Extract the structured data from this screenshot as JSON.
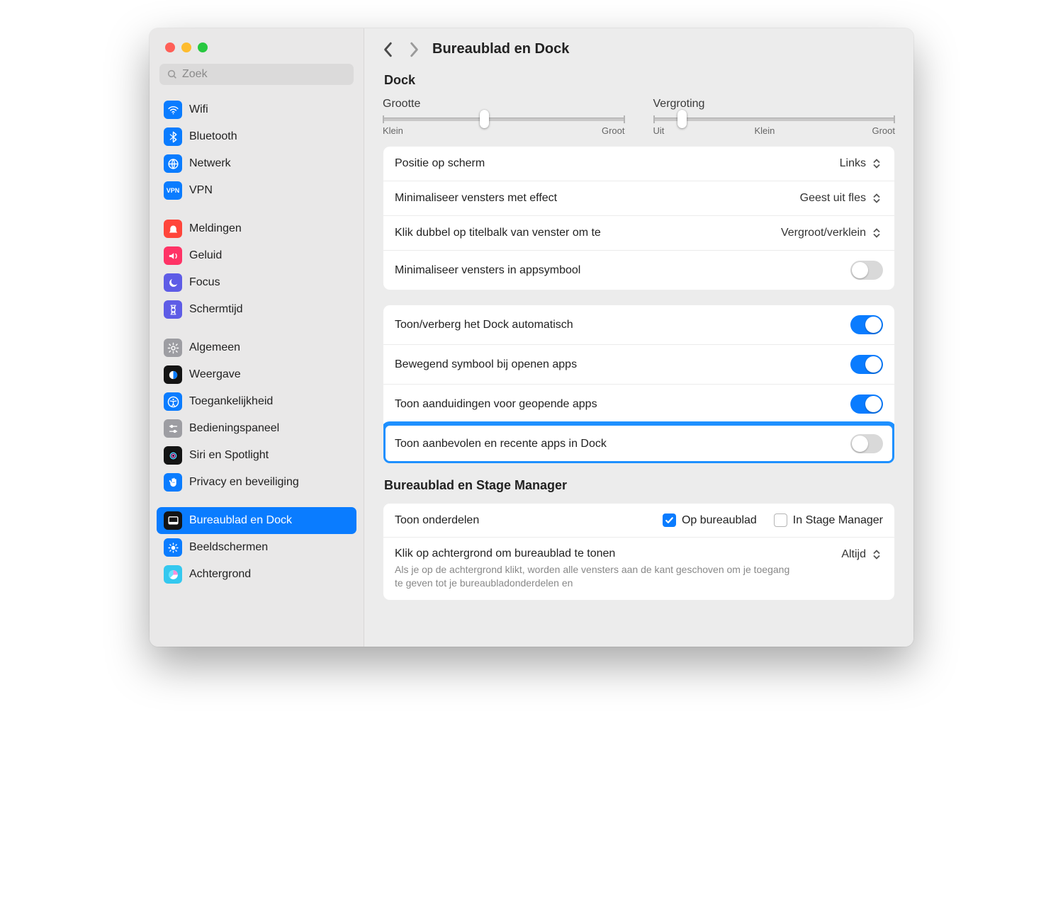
{
  "search": {
    "placeholder": "Zoek"
  },
  "header": {
    "title": "Bureaublad en Dock"
  },
  "sidebar": {
    "groups": [
      [
        {
          "label": "Wifi",
          "bg": "#0a7cff",
          "glyph": "wifi"
        },
        {
          "label": "Bluetooth",
          "bg": "#0a7cff",
          "glyph": "bluetooth"
        },
        {
          "label": "Netwerk",
          "bg": "#0a7cff",
          "glyph": "globe"
        },
        {
          "label": "VPN",
          "bg": "#0a7cff",
          "glyph": "vpn"
        }
      ],
      [
        {
          "label": "Meldingen",
          "bg": "#ff453a",
          "glyph": "bell"
        },
        {
          "label": "Geluid",
          "bg": "#ff3366",
          "glyph": "sound"
        },
        {
          "label": "Focus",
          "bg": "#5e5ce6",
          "glyph": "moon"
        },
        {
          "label": "Schermtijd",
          "bg": "#5e5ce6",
          "glyph": "hourglass"
        }
      ],
      [
        {
          "label": "Algemeen",
          "bg": "#9d9da2",
          "glyph": "gear"
        },
        {
          "label": "Weergave",
          "bg": "#141414",
          "glyph": "appearance"
        },
        {
          "label": "Toegankelijkheid",
          "bg": "#0a7cff",
          "glyph": "accessibility"
        },
        {
          "label": "Bedieningspaneel",
          "bg": "#9d9da2",
          "glyph": "sliders"
        },
        {
          "label": "Siri en Spotlight",
          "bg": "#141414",
          "glyph": "siri"
        },
        {
          "label": "Privacy en beveiliging",
          "bg": "#0a7cff",
          "glyph": "hand"
        }
      ],
      [
        {
          "label": "Bureaublad en Dock",
          "bg": "#141414",
          "glyph": "dock",
          "selected": true
        },
        {
          "label": "Beeldschermen",
          "bg": "#0a7cff",
          "glyph": "display"
        },
        {
          "label": "Achtergrond",
          "bg": "#34c8ef",
          "glyph": "wallpaper"
        }
      ]
    ]
  },
  "dock": {
    "section_title": "Dock",
    "size": {
      "label": "Grootte",
      "min": "Klein",
      "max": "Groot",
      "value_pct": 42
    },
    "mag": {
      "label": "Vergroting",
      "off": "Uit",
      "min": "Klein",
      "max": "Groot",
      "value_pct": 12
    },
    "rows1": [
      {
        "label": "Positie op scherm",
        "value": "Links",
        "type": "popup"
      },
      {
        "label": "Minimaliseer vensters met effect",
        "value": "Geest uit fles",
        "type": "popup"
      },
      {
        "label": "Klik dubbel op titelbalk van venster om te",
        "value": "Vergroot/verklein",
        "type": "popup"
      },
      {
        "label": "Minimaliseer vensters in appsymbool",
        "type": "switch",
        "on": false
      }
    ],
    "rows2": [
      {
        "label": "Toon/verberg het Dock automatisch",
        "type": "switch",
        "on": true
      },
      {
        "label": "Bewegend symbool bij openen apps",
        "type": "switch",
        "on": true
      },
      {
        "label": "Toon aanduidingen voor geopende apps",
        "type": "switch",
        "on": true
      },
      {
        "label": "Toon aanbevolen en recente apps in Dock",
        "type": "switch",
        "on": false,
        "highlight": true
      }
    ]
  },
  "stage": {
    "section_title": "Bureaublad en Stage Manager",
    "show_items": {
      "label": "Toon onderdelen",
      "opt1": "Op bureaublad",
      "opt2": "In Stage Manager",
      "opt1_checked": true,
      "opt2_checked": false
    },
    "click_bg": {
      "label": "Klik op achtergrond om bureaublad te tonen",
      "value": "Altijd",
      "desc": "Als je op de achtergrond klikt, worden alle vensters aan de kant geschoven om je toegang te geven tot je bureaubladonderdelen en"
    }
  },
  "icons": {
    "wifi": "wifi",
    "bluetooth": "bluetooth",
    "globe": "globe",
    "vpn": "VPN",
    "bell": "bell",
    "sound": "sound",
    "moon": "moon",
    "hourglass": "hourglass",
    "gear": "gear",
    "appearance": "appearance",
    "accessibility": "accessibility",
    "sliders": "sliders",
    "siri": "siri",
    "hand": "hand",
    "dock": "dock",
    "display": "display",
    "wallpaper": "wallpaper"
  }
}
